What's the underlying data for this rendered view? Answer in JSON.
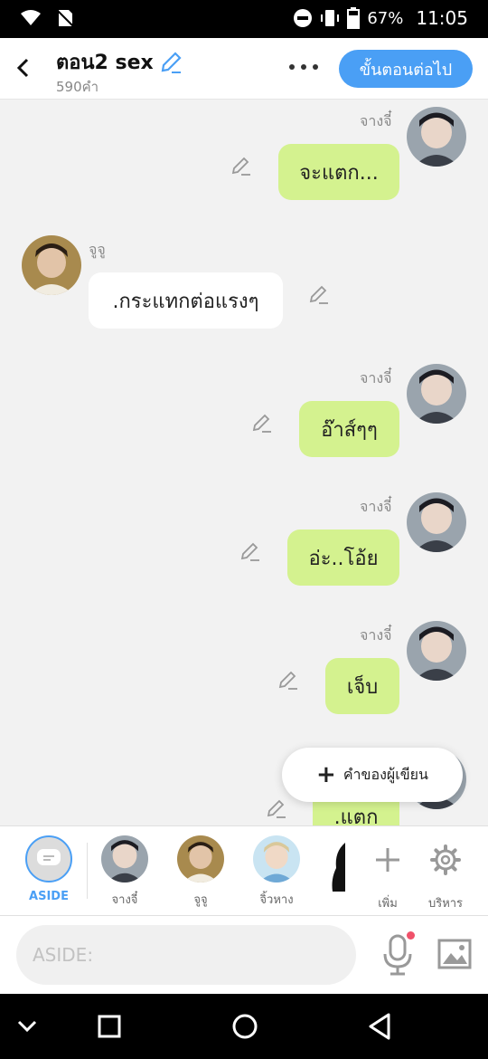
{
  "status": {
    "battery": "67%",
    "time": "11:05"
  },
  "header": {
    "title": "ตอน2 sex",
    "word_count": "590คำ",
    "next_label": "ขั้นตอนต่อไป"
  },
  "messages": [
    {
      "side": "right",
      "name": "จางจี๋",
      "text": "จะแตก..."
    },
    {
      "side": "left",
      "name": "จูจู",
      "text": ".กระแทกต่อแรงๆ"
    },
    {
      "side": "right",
      "name": "จางจี๋",
      "text": "อ๊าส์ๆๆ"
    },
    {
      "side": "right",
      "name": "จางจี๋",
      "text": "อ่ะ..โอ้ย"
    },
    {
      "side": "right",
      "name": "จางจี๋",
      "text": "เจ็บ"
    },
    {
      "side": "right",
      "name": "",
      "text": ".แตก"
    }
  ],
  "writer_button": "คำของผู้เขียน",
  "cast": {
    "aside": "ASIDE",
    "members": [
      "จางจี๋",
      "จูจู",
      "จิ้วหาง"
    ],
    "add": "เพิ่ม",
    "manage": "บริหาร"
  },
  "input": {
    "placeholder": "ASIDE:"
  },
  "colors": {
    "accent": "#4a9ff5",
    "my_bubble": "#d4f28f",
    "mic_dot": "#f0516a"
  },
  "icons": [
    "back-icon",
    "edit-icon",
    "more-icon",
    "pencil-icon",
    "plus-icon",
    "gear-icon",
    "mic-icon",
    "image-icon",
    "nav-back-icon",
    "nav-home-icon",
    "nav-recents-icon"
  ]
}
